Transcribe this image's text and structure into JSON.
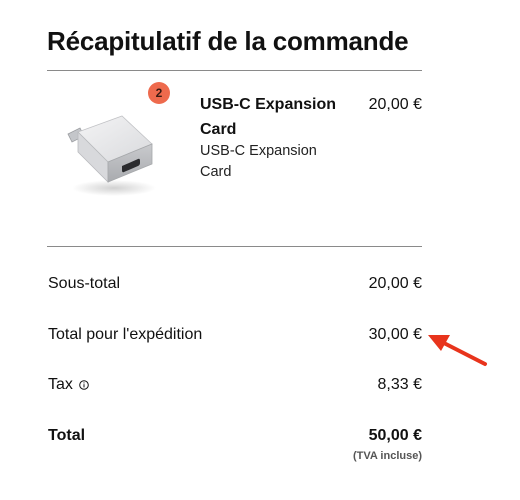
{
  "summary": {
    "title": "Récapitulatif de la commande",
    "item": {
      "quantity": "2",
      "name": "USB-C Expansion Card",
      "variant": "USB-C Expansion Card",
      "price": "20,00 €",
      "image_icon": "usb-c-expansion-card-image"
    },
    "subtotal": {
      "label": "Sous-total",
      "value": "20,00 €"
    },
    "shipping": {
      "label": "Total pour l'expédition",
      "value": "30,00 €"
    },
    "tax": {
      "label": "Tax",
      "value": "8,33 €",
      "icon": "info-icon"
    },
    "total": {
      "label": "Total",
      "value": "50,00 €",
      "note": "(TVA incluse)"
    }
  },
  "annotation": {
    "arrow_color": "#e8341c",
    "arrow_icon": "red-arrow-icon"
  },
  "colors": {
    "badge": "#ee6a4d",
    "divider": "#8a8a8a"
  }
}
